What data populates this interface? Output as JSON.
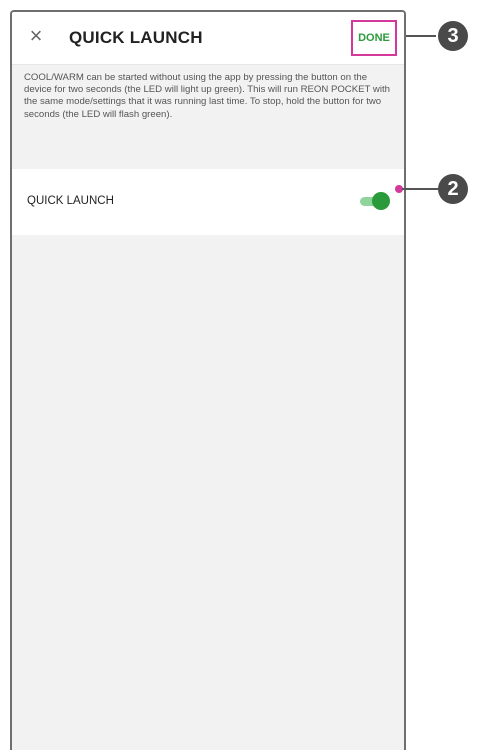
{
  "header": {
    "title": "QUICK LAUNCH",
    "done_label": "DONE"
  },
  "description": "COOL/WARM can be started without using the app by pressing the button on the device for two seconds (the LED will light up green). This will run REON POCKET with the same mode/settings that it was running last time. To stop, hold the button for two seconds (the LED will flash green).",
  "setting": {
    "label": "QUICK LAUNCH",
    "enabled": true
  },
  "callouts": {
    "done": "3",
    "toggle": "2"
  },
  "colors": {
    "accent_green": "#2a9a3a",
    "highlight": "#d3389a"
  }
}
